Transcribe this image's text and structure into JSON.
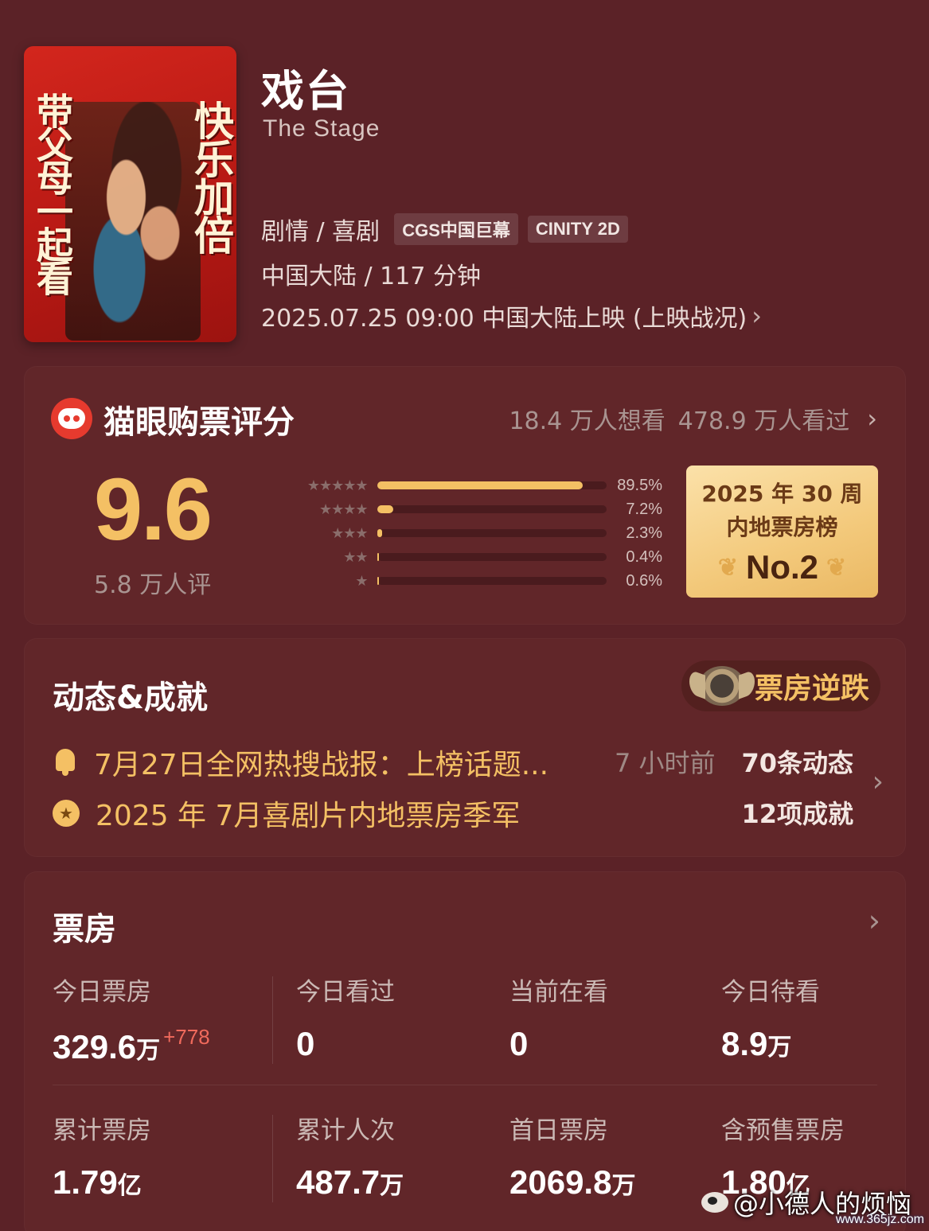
{
  "movie": {
    "title": "戏台",
    "title_en": "The Stage",
    "genres": "剧情 / 喜剧",
    "tags": [
      "CGS中国巨幕",
      "CINITY 2D"
    ],
    "region_duration": "中国大陆 / 117 分钟",
    "release": "2025.07.25 09:00 中国大陆上映 (上映战况)",
    "poster_text_left": "带父母一起看",
    "poster_text_right": "快乐加倍"
  },
  "rating": {
    "title": "猫眼购票评分",
    "want": "18.4 万人想看",
    "watched": "478.9 万人看过",
    "score": "9.6",
    "count": "5.8 万人评",
    "distribution": [
      {
        "stars": "★★★★★",
        "pct_label": "89.5%",
        "value": 89.5
      },
      {
        "stars": "★★★★",
        "pct_label": "7.2%",
        "value": 7.2
      },
      {
        "stars": "★★★",
        "pct_label": "2.3%",
        "value": 2.3
      },
      {
        "stars": "★★",
        "pct_label": "0.4%",
        "value": 0.4
      },
      {
        "stars": "★",
        "pct_label": "0.6%",
        "value": 0.6
      }
    ],
    "rank": {
      "line1": "2025 年 30 周",
      "line2": "内地票房榜",
      "no": "No.2"
    }
  },
  "dynamics": {
    "title": "动态&成就",
    "badge": "票房逆跌",
    "item1": "7月27日全网热搜战报：上榜话题...",
    "item1_time": "7 小时前",
    "item2": "2025 年 7月喜剧片内地票房季军",
    "count1": "70条动态",
    "count2": "12项成就"
  },
  "boxoffice": {
    "title": "票房",
    "today_label": "今日票房",
    "today_value": "329.6",
    "today_unit": "万",
    "today_delta": "+778",
    "watched_today_label": "今日看过",
    "watched_today_value": "0",
    "watching_label": "当前在看",
    "watching_value": "0",
    "to_watch_label": "今日待看",
    "to_watch_value": "8.9",
    "to_watch_unit": "万",
    "total_label": "累计票房",
    "total_value": "1.79",
    "total_unit": "亿",
    "admissions_label": "累计人次",
    "admissions_value": "487.7",
    "admissions_unit": "万",
    "first_day_label": "首日票房",
    "first_day_value": "2069.8",
    "first_day_unit": "万",
    "presale_label": "含预售票房",
    "presale_value": "1.80",
    "presale_unit": "亿"
  },
  "watermark": {
    "text": "@小德人的烦恼",
    "site": "www.365jz.com"
  },
  "colors": {
    "background": "#5b2227",
    "card": "#612629",
    "accent_gold": "#f4c064",
    "delta_red": "#f06a5c"
  }
}
